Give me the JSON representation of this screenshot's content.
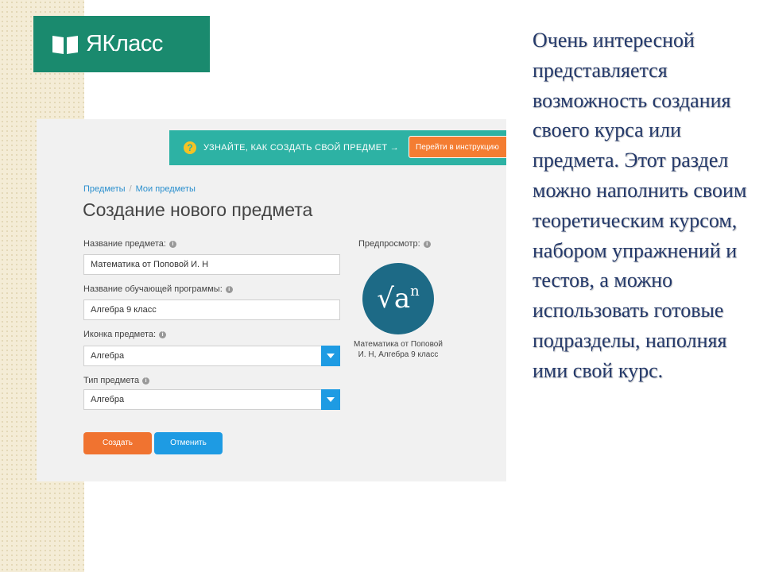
{
  "logo": {
    "text": "ЯКласс",
    "brand_color": "#1a8a6e",
    "icon": "book-icon"
  },
  "screenshot": {
    "banner": {
      "icon": "question-icon",
      "text": "УЗНАЙТЕ, КАК СОЗДАТЬ СВОЙ ПРЕДМЕТ →",
      "button_label": "Перейти в инструкцию",
      "color": "#2db2a4",
      "button_color": "#f47d32"
    },
    "breadcrumb": {
      "items": [
        "Предметы",
        "Мои предметы"
      ],
      "separator": "/"
    },
    "page_title": "Создание нового предмета",
    "form": {
      "subject_name_label": "Название предмета:",
      "subject_name_value": "Математика от Поповой И. Н",
      "program_name_label": "Название обучающей программы:",
      "program_name_value": "Алгебра 9 класс",
      "subject_icon_label": "Иконка предмета:",
      "subject_icon_value": "Алгебра",
      "subject_type_label": "Тип предмета",
      "subject_type_value": "Алгебра",
      "info_icon": "info-icon",
      "dropdown_icon": "chevron-down-icon"
    },
    "preview": {
      "label": "Предпросмотр:",
      "symbol": "√a",
      "symbol_exponent": "n",
      "caption": "Математика от Поповой И. Н, Алгебра 9 класс",
      "circle_color": "#1d6a86"
    },
    "buttons": {
      "create": "Создать",
      "cancel": "Отменить",
      "create_color": "#f07330",
      "cancel_color": "#1e9be3"
    }
  },
  "description": "Очень интересной представляется возможность создания своего курса или предмета. Этот раздел можно наполнить своим теоретическим курсом, набором упражнений и тестов, а можно использовать готовые подразделы, наполняя ими свой курс."
}
